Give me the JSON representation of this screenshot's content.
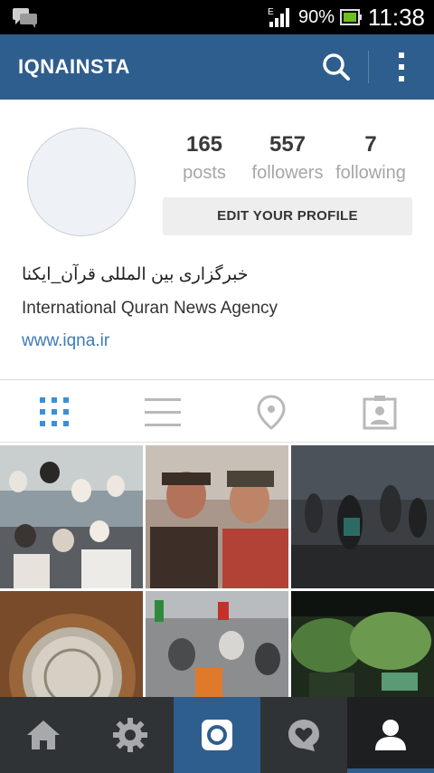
{
  "status_bar": {
    "signal_type": "E",
    "battery_percent": "90%",
    "time": "11:38",
    "icons": [
      "chat-notification-icon",
      "signal-icon",
      "battery-charging-icon"
    ]
  },
  "app_bar": {
    "title": "IQNAINSTA",
    "icons": [
      "search-icon",
      "overflow-menu-icon"
    ],
    "color": "#2e5e8e"
  },
  "profile": {
    "stats": [
      {
        "value": "165",
        "label": "posts"
      },
      {
        "value": "557",
        "label": "followers"
      },
      {
        "value": "7",
        "label": "following"
      }
    ],
    "edit_button": "EDIT YOUR PROFILE",
    "bio_persian": "خبرگزاری بین المللی قرآن_ایکنا",
    "bio_english": "International Quran News Agency",
    "website": "www.iqna.ir",
    "link_color": "#3d7ab8"
  },
  "view_tabs": [
    {
      "name": "grid-view",
      "icon": "grid-icon",
      "active": true
    },
    {
      "name": "list-view",
      "icon": "list-icon",
      "active": false
    },
    {
      "name": "map-view",
      "icon": "location-pin-icon",
      "active": false
    },
    {
      "name": "tagged-view",
      "icon": "tagged-photos-icon",
      "active": false
    }
  ],
  "photos": [
    {
      "subject": "group of clerics and men posing together"
    },
    {
      "subject": "two young men in vintage photo"
    },
    {
      "subject": "women in chadors seated outdoors at dusk"
    },
    {
      "subject": "ornate engraved silver medallion"
    },
    {
      "subject": "crowd at street demonstration with flags"
    },
    {
      "subject": "green trees and gathering outdoors"
    }
  ],
  "bottom_nav": [
    {
      "name": "home",
      "icon": "home-icon",
      "active": false
    },
    {
      "name": "explore",
      "icon": "explore-star-icon",
      "active": false
    },
    {
      "name": "camera",
      "icon": "camera-icon",
      "active": false
    },
    {
      "name": "activity",
      "icon": "heart-bubble-icon",
      "active": false
    },
    {
      "name": "profile",
      "icon": "profile-icon",
      "active": true
    }
  ]
}
